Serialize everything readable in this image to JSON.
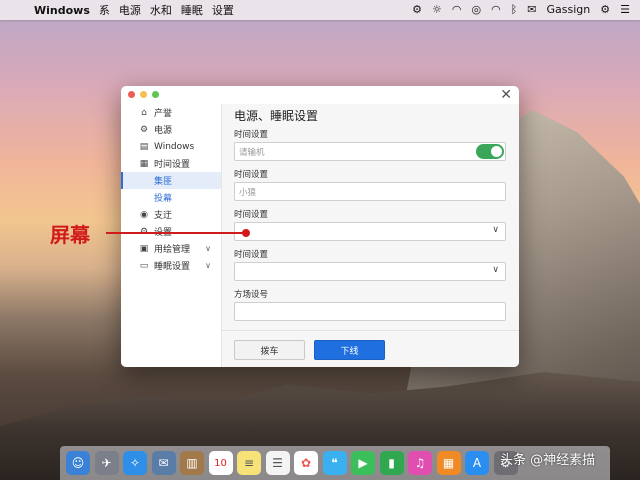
{
  "menubar": {
    "app_name": "Windows",
    "items": [
      "系",
      "电源",
      "水和",
      "睡眠",
      "设置"
    ],
    "user": "Gassign",
    "status_icons": [
      "airplay-icon",
      "brightness-icon",
      "wifi-icon",
      "location-icon",
      "wifi-icon",
      "bluetooth-icon",
      "mail-icon",
      "menu-icon",
      "search-icon",
      "list-icon"
    ]
  },
  "sidebar": {
    "items": [
      {
        "label": "产誉",
        "icon": "home-icon"
      },
      {
        "label": "电源",
        "icon": "gear-icon"
      },
      {
        "label": "Windows",
        "icon": "document-icon"
      },
      {
        "label": "时间设置",
        "icon": "calendar-icon"
      },
      {
        "label": "集匪",
        "icon": "",
        "sub": true,
        "active": true
      },
      {
        "label": "投幕",
        "icon": "",
        "sub": true
      },
      {
        "label": "支迂",
        "icon": "location-icon"
      },
      {
        "label": "设置",
        "icon": "gear-icon"
      },
      {
        "label": "用绘管理",
        "icon": "grid-icon",
        "chevron": true
      },
      {
        "label": "睡眠设置",
        "icon": "battery-icon",
        "chevron": true
      }
    ]
  },
  "main": {
    "title": "电源、睡眠设置",
    "fields": [
      {
        "label": "时间设置",
        "placeholder": "请输机",
        "type": "toggle",
        "enabled": true
      },
      {
        "label": "时间设置",
        "placeholder": "小猿",
        "type": "text"
      },
      {
        "label": "时间设置",
        "placeholder": "",
        "type": "select"
      },
      {
        "label": "时间设置",
        "placeholder": "",
        "type": "select"
      },
      {
        "label": "方场设号",
        "placeholder": "",
        "type": "text"
      }
    ],
    "cancel_label": "拨车",
    "ok_label": "下线"
  },
  "annotation": {
    "text": "屏幕",
    "color": "#d11b1b"
  },
  "dock": {
    "icons": [
      "finder-icon",
      "launchpad-icon",
      "safari-icon",
      "stamp-icon",
      "notes-book-icon",
      "calendar-icon",
      "notes-icon",
      "reminders-icon",
      "photos-icon",
      "messages-icon",
      "facetime-icon",
      "numbers-icon",
      "itunes-icon",
      "books-icon",
      "appstore-icon",
      "settings-icon"
    ],
    "calendar_day": "10"
  },
  "watermark": "头条 @神经素描",
  "colors": {
    "accent": "#1f6fe0",
    "toggle": "#3aa65a",
    "annotation": "#d11b1b"
  }
}
